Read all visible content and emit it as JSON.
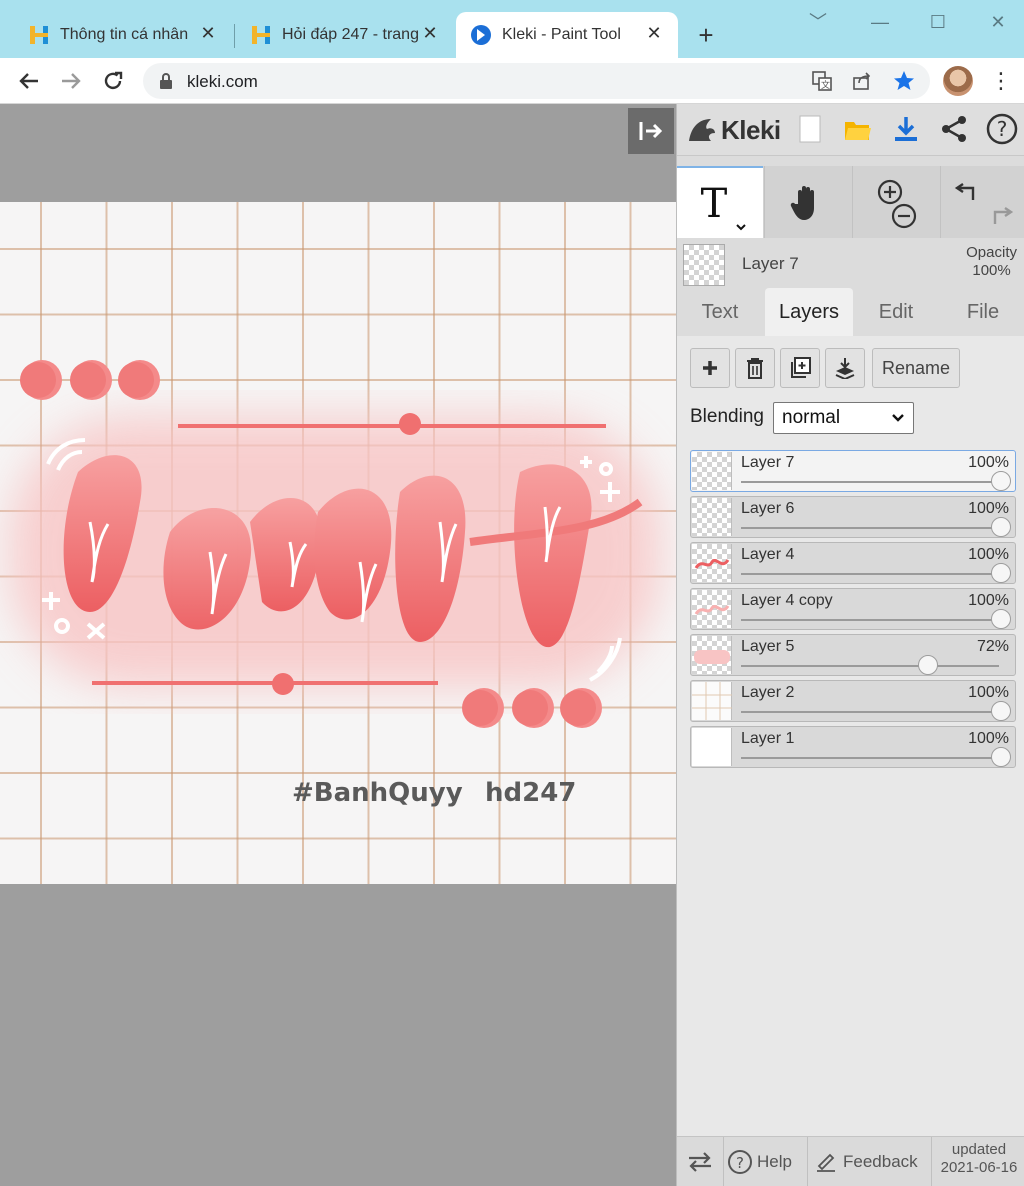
{
  "browser": {
    "tabs": [
      {
        "title": "Thông tin cá nhân",
        "active": false
      },
      {
        "title": "Hỏi đáp 247 - trang",
        "active": false
      },
      {
        "title": "Kleki - Paint Tool",
        "active": true
      }
    ],
    "url": "kleki.com"
  },
  "colors": {
    "tabstrip": "#a9e1ee",
    "art_pink": "#f07a7a",
    "art_pink_light": "#f8c4c4",
    "kleki_blue": "#1b6ed6"
  },
  "artwork": {
    "hashtag": "#BanhQuyy",
    "watermark": "hd247"
  },
  "kleki": {
    "brand": "Kleki",
    "current_layer": {
      "name": "Layer 7",
      "opacity_label": "Opacity",
      "opacity_value": "100%"
    },
    "panel_tabs": [
      {
        "label": "Text",
        "active": false
      },
      {
        "label": "Layers",
        "active": true
      },
      {
        "label": "Edit",
        "active": false
      },
      {
        "label": "File",
        "active": false
      }
    ],
    "rename_label": "Rename",
    "blending_label": "Blending",
    "blending_value": "normal",
    "layers": [
      {
        "name": "Layer 7",
        "opacity": "100%",
        "opacity_frac": 1.0,
        "selected": true
      },
      {
        "name": "Layer 6",
        "opacity": "100%",
        "opacity_frac": 1.0,
        "selected": false
      },
      {
        "name": "Layer 4",
        "opacity": "100%",
        "opacity_frac": 1.0,
        "selected": false
      },
      {
        "name": "Layer 4 copy",
        "opacity": "100%",
        "opacity_frac": 1.0,
        "selected": false
      },
      {
        "name": "Layer 5",
        "opacity": "72%",
        "opacity_frac": 0.72,
        "selected": false
      },
      {
        "name": "Layer 2",
        "opacity": "100%",
        "opacity_frac": 1.0,
        "selected": false
      },
      {
        "name": "Layer 1",
        "opacity": "100%",
        "opacity_frac": 1.0,
        "selected": false
      }
    ],
    "footer": {
      "help": "Help",
      "feedback": "Feedback",
      "updated_label": "updated",
      "updated_date": "2021-06-16"
    }
  }
}
